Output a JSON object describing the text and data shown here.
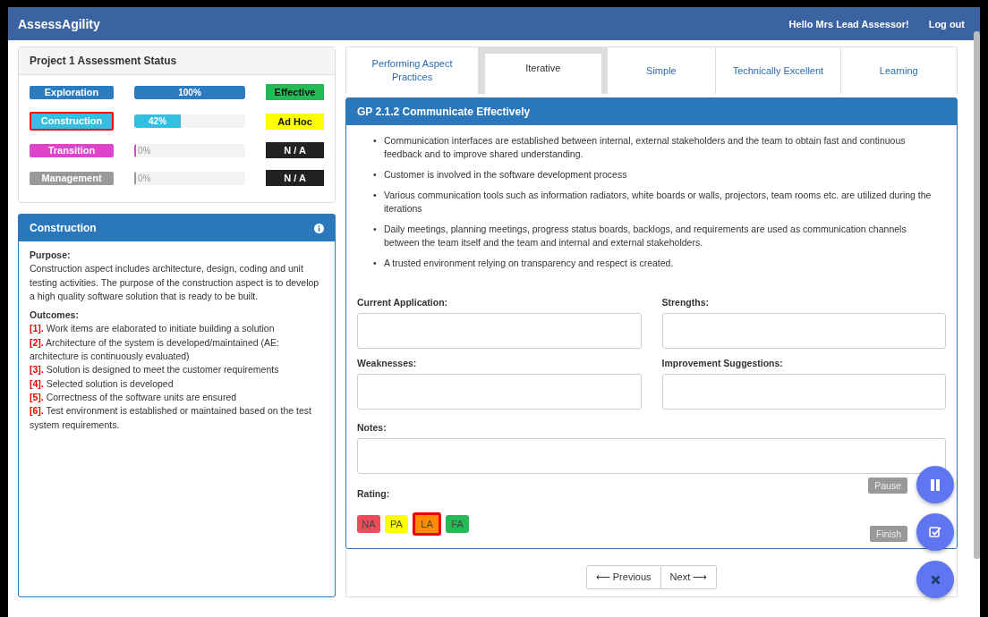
{
  "navbar": {
    "brand": "AssessAgility",
    "greeting": "Hello Mrs Lead Assessor!",
    "logout": "Log out"
  },
  "status_panel": {
    "title": "Project 1 Assessment Status",
    "aspects": [
      {
        "name": "Exploration",
        "color": "#2a7bbf",
        "selected": false,
        "level": 1,
        "percent": "100%",
        "rating": {
          "text": "Effective",
          "color": "#22bb55"
        }
      },
      {
        "name": "Construction",
        "color": "#33c0e0",
        "selected": true,
        "level": 0.42,
        "percent": "42%",
        "rating": {
          "text": "Ad Hoc",
          "color": "#ffff00"
        }
      },
      {
        "name": "Transition",
        "color": "#dd44cc",
        "selected": false,
        "level": 0,
        "percent": "0%",
        "rating": {
          "text": "N / A",
          "color": "#222222"
        }
      },
      {
        "name": "Management",
        "color": "#999999",
        "selected": false,
        "level": 0,
        "percent": "0%",
        "rating": {
          "text": "N / A",
          "color": "#222222"
        }
      }
    ]
  },
  "info_panel": {
    "title": "Construction",
    "purpose_label": "Purpose:",
    "purpose": "Construction aspect includes architecture, design, coding and unit testing activities. The purpose of the construction aspect is to develop a high quality software solution that is ready to be built.",
    "outcomes_label": "Outcomes:",
    "outcomes": [
      {
        "mark": "[1].",
        "text": "Work items are elaborated to initiate building a solution"
      },
      {
        "mark": "[2].",
        "text": "Architecture of the system is developed/maintained (AE: architecture is continuously evaluated)"
      },
      {
        "mark": "[3].",
        "text": "Solution is designed to meet the customer requirements"
      },
      {
        "mark": "[4].",
        "text": "Selected solution is developed"
      },
      {
        "mark": "[5].",
        "text": "Correctness of the software units are ensured"
      },
      {
        "mark": "[6].",
        "text": "Test environment is established or maintained based on the test system requirements."
      }
    ]
  },
  "tabs": [
    {
      "label": "Performing Aspect Practices",
      "selected": false
    },
    {
      "label": "Iterative",
      "selected": true
    },
    {
      "label": "Simple",
      "selected": false
    },
    {
      "label": "Technically Excellent",
      "selected": false
    },
    {
      "label": "Learning",
      "selected": false
    }
  ],
  "practice": {
    "title": "GP 2.1.2 Communicate Effectively",
    "bullets": [
      {
        "marker": "•",
        "text": "Communication interfaces are established between internal, external stakeholders and the team to obtain fast and continuous feedback and to improve shared understanding."
      },
      {
        "marker": "•",
        "text": "Customer is involved in the software development process"
      },
      {
        "marker": "•",
        "text": "Various communication tools such as information radiators, white boards or walls, projectors, team rooms etc. are utilized during the iterations"
      },
      {
        "marker": "•",
        "text": "Daily meetings, planning meetings, progress status boards, backlogs, and requirements are used as communication channels between the team itself and the team and internal and external stakeholders."
      },
      {
        "marker": "•",
        "text": "A trusted environment relying on transparency and respect is created."
      }
    ],
    "fields": [
      {
        "label": "Current Application:"
      },
      {
        "label": "Strengths:"
      },
      {
        "label": "Weaknesses:"
      },
      {
        "label": "Improvement Suggestions:"
      }
    ],
    "notes_label": "Notes:",
    "rating_label": "Rating:",
    "ratings": [
      {
        "label": "NA",
        "color": "#f04a5a",
        "selected": false
      },
      {
        "label": "PA",
        "color": "#ffff00",
        "selected": false
      },
      {
        "label": "LA",
        "color": "#ff8c00",
        "selected": true
      },
      {
        "label": "FA",
        "color": "#22bb55",
        "selected": false
      }
    ]
  },
  "pager": {
    "previous": "⟵ Previous",
    "next": "Next ⟶"
  },
  "fab": {
    "pause": "Pause",
    "finish": "Finish"
  }
}
